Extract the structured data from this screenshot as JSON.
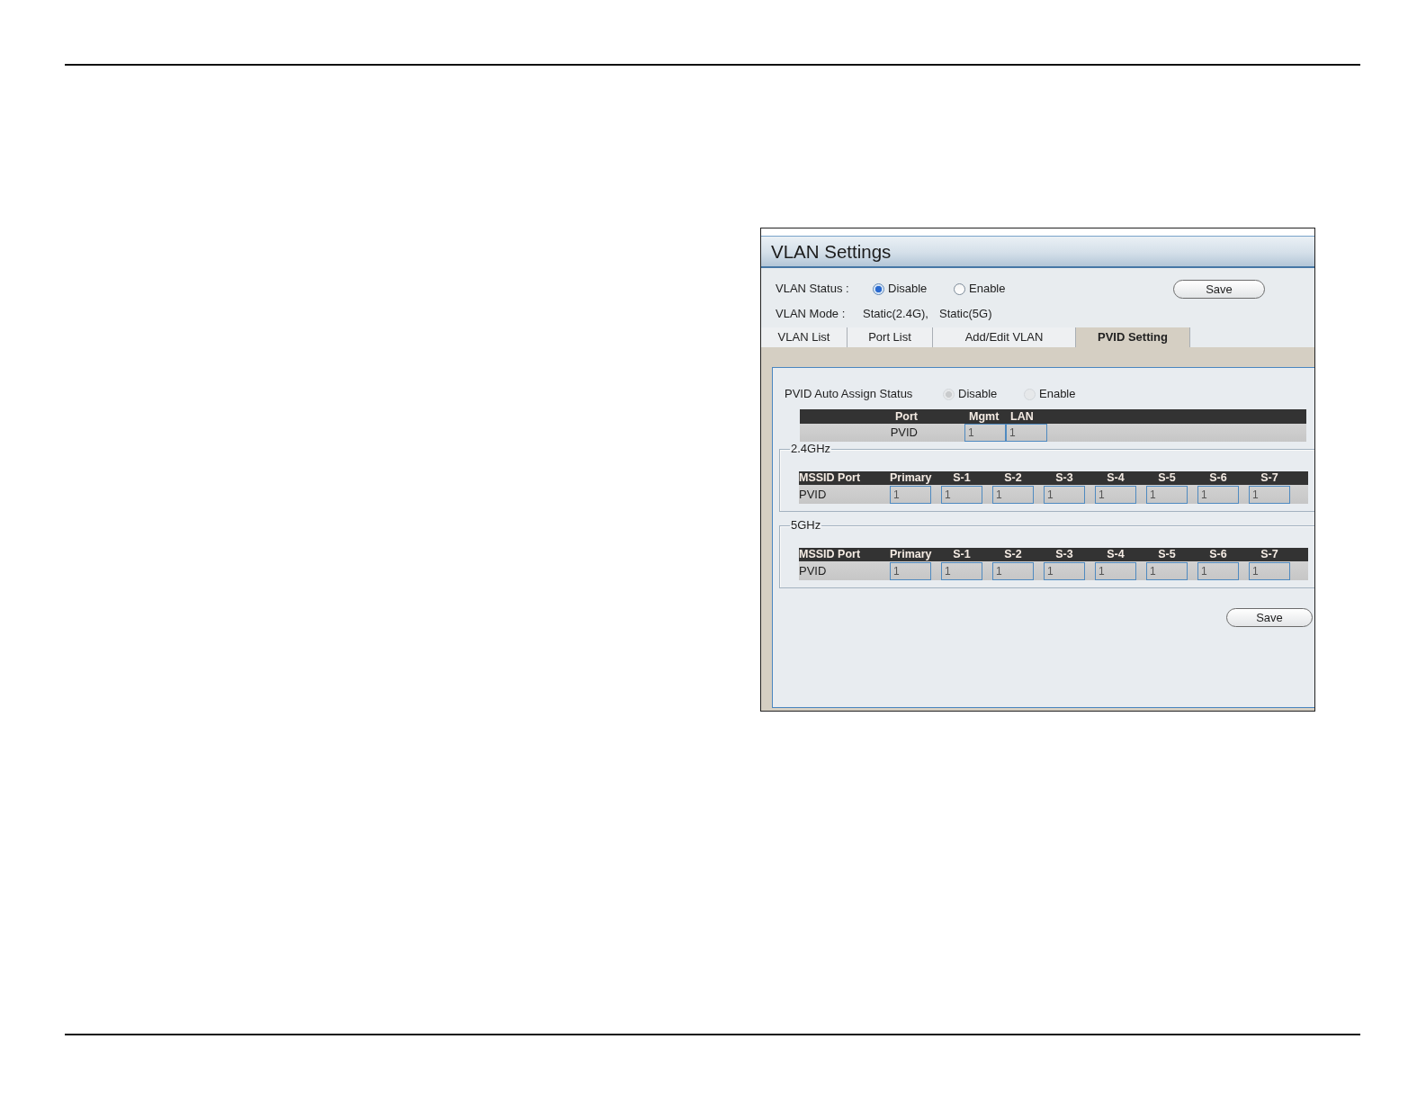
{
  "window": {
    "title": "VLAN Settings"
  },
  "vlan_status": {
    "label": "VLAN Status :",
    "options": [
      {
        "label": "Disable",
        "selected": true
      },
      {
        "label": "Enable",
        "selected": false
      }
    ]
  },
  "save_button_top": {
    "label": "Save"
  },
  "vlan_mode": {
    "label": "VLAN Mode :",
    "values": [
      "Static(2.4G),",
      "Static(5G)"
    ]
  },
  "tabs": [
    {
      "label": "VLAN List",
      "selected": false
    },
    {
      "label": "Port List",
      "selected": false
    },
    {
      "label": "Add/Edit VLAN",
      "selected": false
    },
    {
      "label": "PVID Setting",
      "selected": true
    }
  ],
  "pvid_auto_assign": {
    "label": "PVID Auto Assign Status",
    "disabled": true,
    "options": [
      {
        "label": "Disable",
        "selected": true
      },
      {
        "label": "Enable",
        "selected": false
      }
    ]
  },
  "port_table": {
    "columns": [
      "Port",
      "Mgmt",
      "LAN"
    ],
    "rows": [
      {
        "label": "PVID",
        "values": [
          "1",
          "1"
        ]
      }
    ]
  },
  "bands": [
    {
      "legend": "2.4GHz",
      "columns": [
        "MSSID Port",
        "Primary",
        "S-1",
        "S-2",
        "S-3",
        "S-4",
        "S-5",
        "S-6",
        "S-7"
      ],
      "rows": [
        {
          "label": "PVID",
          "values": [
            "1",
            "1",
            "1",
            "1",
            "1",
            "1",
            "1",
            "1"
          ]
        }
      ]
    },
    {
      "legend": "5GHz",
      "columns": [
        "MSSID Port",
        "Primary",
        "S-1",
        "S-2",
        "S-3",
        "S-4",
        "S-5",
        "S-6",
        "S-7"
      ],
      "rows": [
        {
          "label": "PVID",
          "values": [
            "1",
            "1",
            "1",
            "1",
            "1",
            "1",
            "1",
            "1"
          ]
        }
      ]
    }
  ],
  "save_button_bottom": {
    "label": "Save"
  }
}
